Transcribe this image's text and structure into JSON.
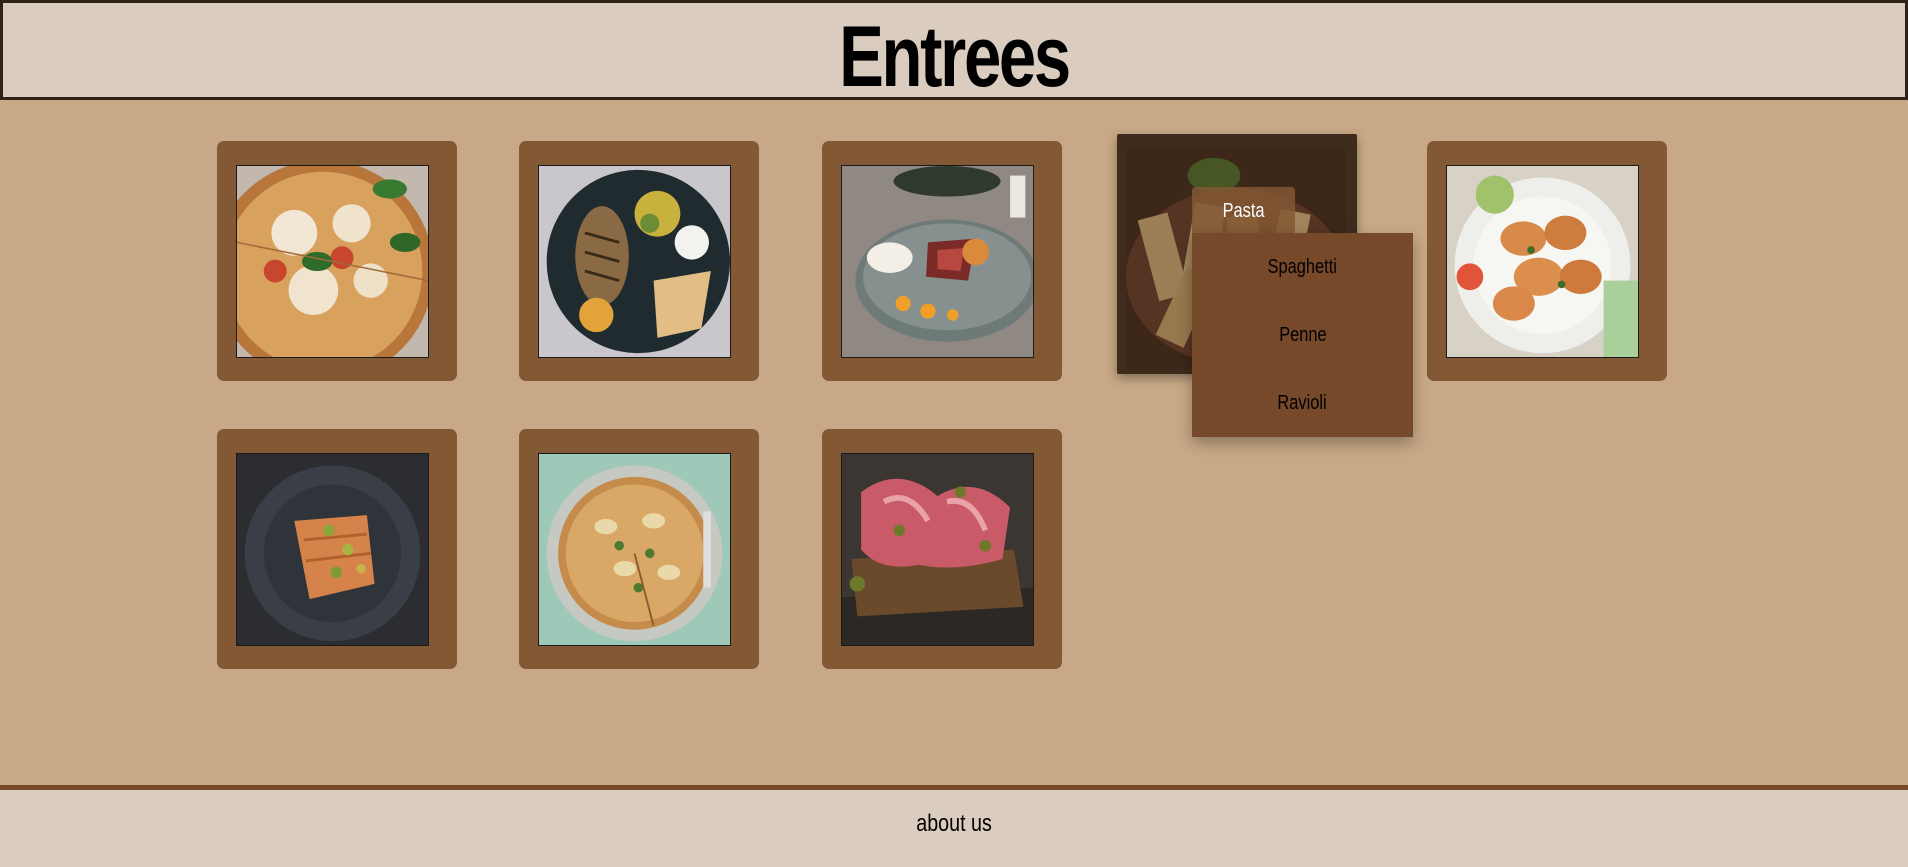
{
  "header": {
    "title": "Entrees"
  },
  "menu": {
    "items": [
      {
        "icon": "pizza-margherita-photo"
      },
      {
        "icon": "grilled-chicken-photo"
      },
      {
        "icon": "steak-plate-photo"
      },
      {
        "icon": "pasta-photo",
        "hover_label": "Pasta"
      },
      {
        "icon": "shrimp-photo"
      },
      {
        "icon": "salmon-photo"
      },
      {
        "icon": "pear-tart-photo"
      },
      {
        "icon": "prosciutto-toast-photo"
      }
    ],
    "dropdown": [
      "Spaghetti",
      "Penne",
      "Ravioli"
    ]
  },
  "footer": {
    "link": "about us"
  },
  "colors": {
    "background": "#c8a886",
    "header_bg": "#dbccc0",
    "card": "#835834",
    "dropdown": "#76492a"
  }
}
